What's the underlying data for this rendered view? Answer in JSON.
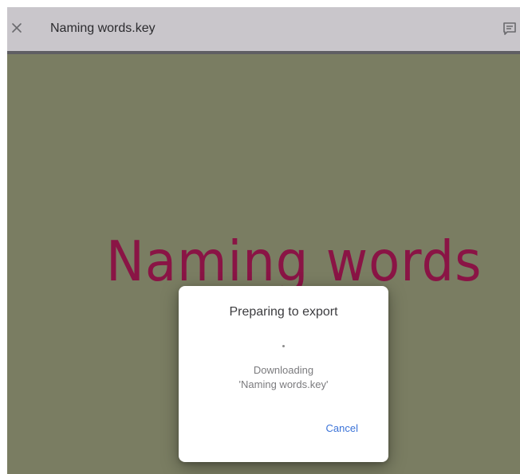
{
  "app": {
    "file_title": "Naming words.key",
    "icons": {
      "close": "close-icon",
      "comment": "comment-icon"
    }
  },
  "slide": {
    "title": "Naming words",
    "background_color": "#7a7d62",
    "title_color": "#8a1445"
  },
  "dialog": {
    "title": "Preparing to export",
    "status": "Downloading",
    "file": "'Naming words.key'",
    "cancel_label": "Cancel",
    "accent_color": "#3b73d8"
  }
}
